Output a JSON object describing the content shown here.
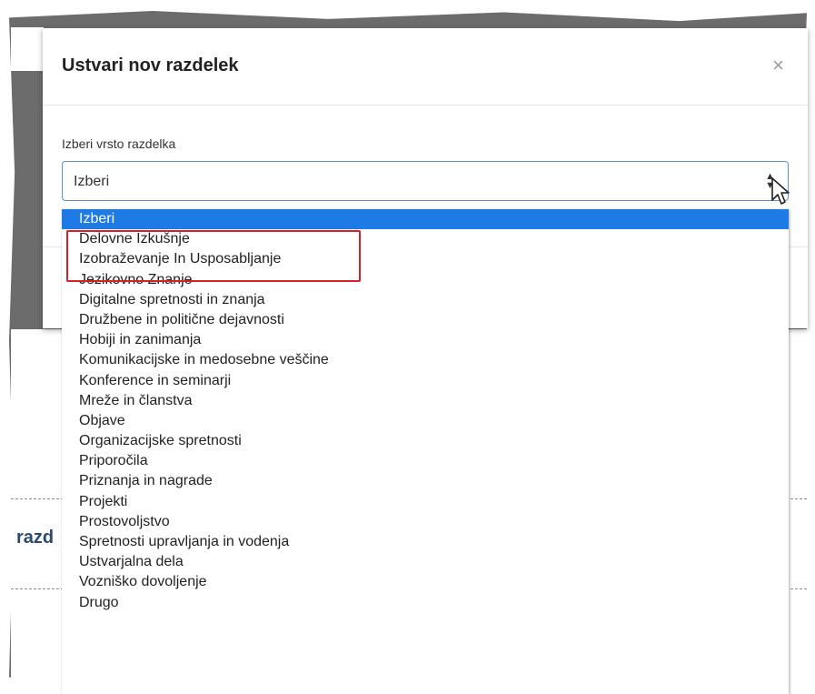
{
  "modal": {
    "title": "Ustvari nov razdelek",
    "close_glyph": "×"
  },
  "field": {
    "label": "Izberi vrsto razdelka",
    "selected_value": "Izberi"
  },
  "dropdown": {
    "options": [
      "Izberi",
      "Delovne Izkušnje",
      "Izobraževanje In Usposabljanje",
      "Jezikovno Znanje",
      "Digitalne spretnosti in znanja",
      "Družbene in politične dejavnosti",
      "Hobiji in zanimanja",
      "Komunikacijske in medosebne veščine",
      "Konference in seminarji",
      "Mreže in članstva",
      "Objave",
      "Organizacijske spretnosti",
      "Priporočila",
      "Priznanja in nagrade",
      "Projekti",
      "Prostovoljstvo",
      "Spretnosti upravljanja in vodenja",
      "Ustvarjalna dela",
      "Vozniško dovoljenje",
      "Drugo"
    ],
    "selected_index": 0
  },
  "background": {
    "heading_fragment": "razd"
  },
  "colors": {
    "selected_option_bg": "#1e7be6",
    "annotation_border": "#d8202a",
    "select_border": "#5b8fd6",
    "heading_color": "#2b4a6f"
  },
  "icons": {
    "close": "close-icon",
    "select_arrows": "updown-chevron-icon",
    "cursor": "mouse-pointer-icon"
  }
}
